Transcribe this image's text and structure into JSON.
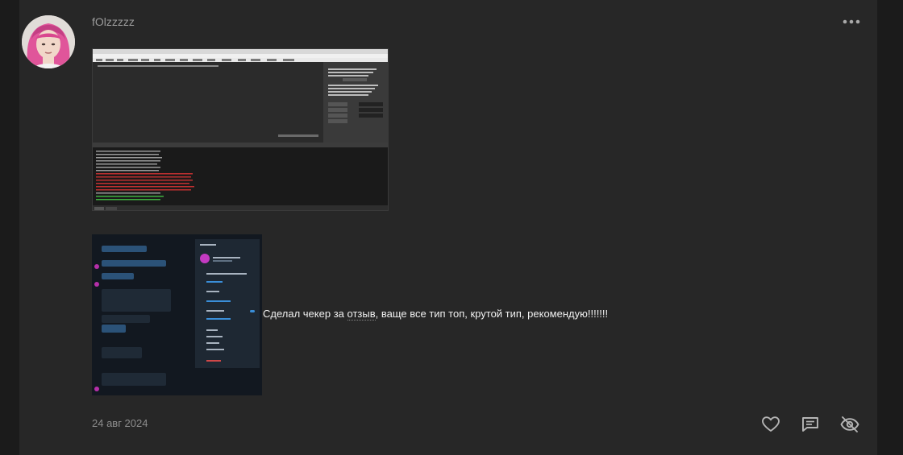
{
  "post": {
    "author": "fOlzzzzz",
    "message": {
      "before": "Сделал чекер за ",
      "underlined": "отзыв",
      "after": ", ваще все тип топ, крутой тип, рекомендую!!!!!!!"
    },
    "date": "24 авг 2024"
  },
  "icons": {
    "more": "more-dots-icon",
    "like": "heart-icon",
    "reply": "comment-icon",
    "hide": "eye-off-icon"
  },
  "colors": {
    "page_bg": "#1b1b1b",
    "card_bg": "#272727",
    "muted_text": "#8e8e8e",
    "text": "#f0f0f0"
  }
}
